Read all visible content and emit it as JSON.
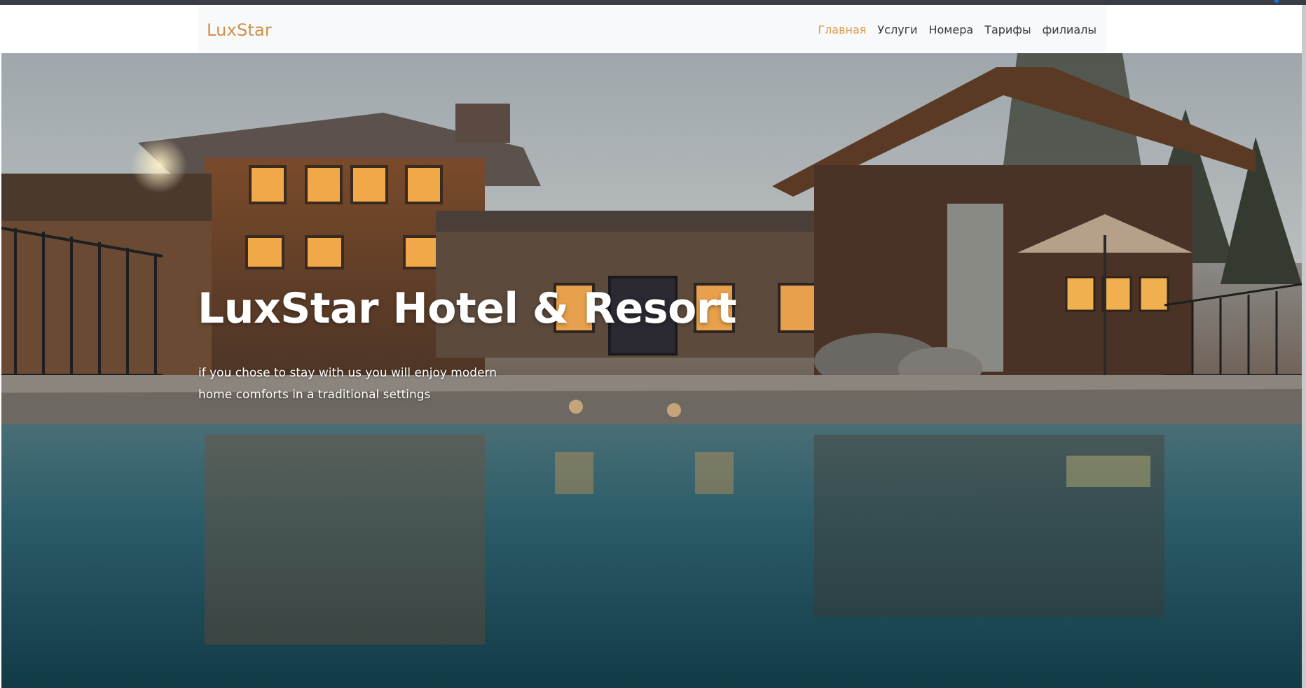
{
  "brand": {
    "name": "LuxStar",
    "color": "#d0904a"
  },
  "nav": {
    "items": [
      {
        "label": "Главная",
        "active": true
      },
      {
        "label": "Услуги",
        "active": false
      },
      {
        "label": "Номера",
        "active": false
      },
      {
        "label": "Тарифы",
        "active": false
      },
      {
        "label": "филиалы",
        "active": false
      }
    ],
    "active_color": "#e09a4e",
    "background": "#f8f9fa"
  },
  "hero": {
    "title": "LuxStar Hotel & Resort",
    "subtitle": "if you chose to stay with us you will enjoy modern home comforts in a traditional settings",
    "background_image": "hotel-pool-photo"
  }
}
